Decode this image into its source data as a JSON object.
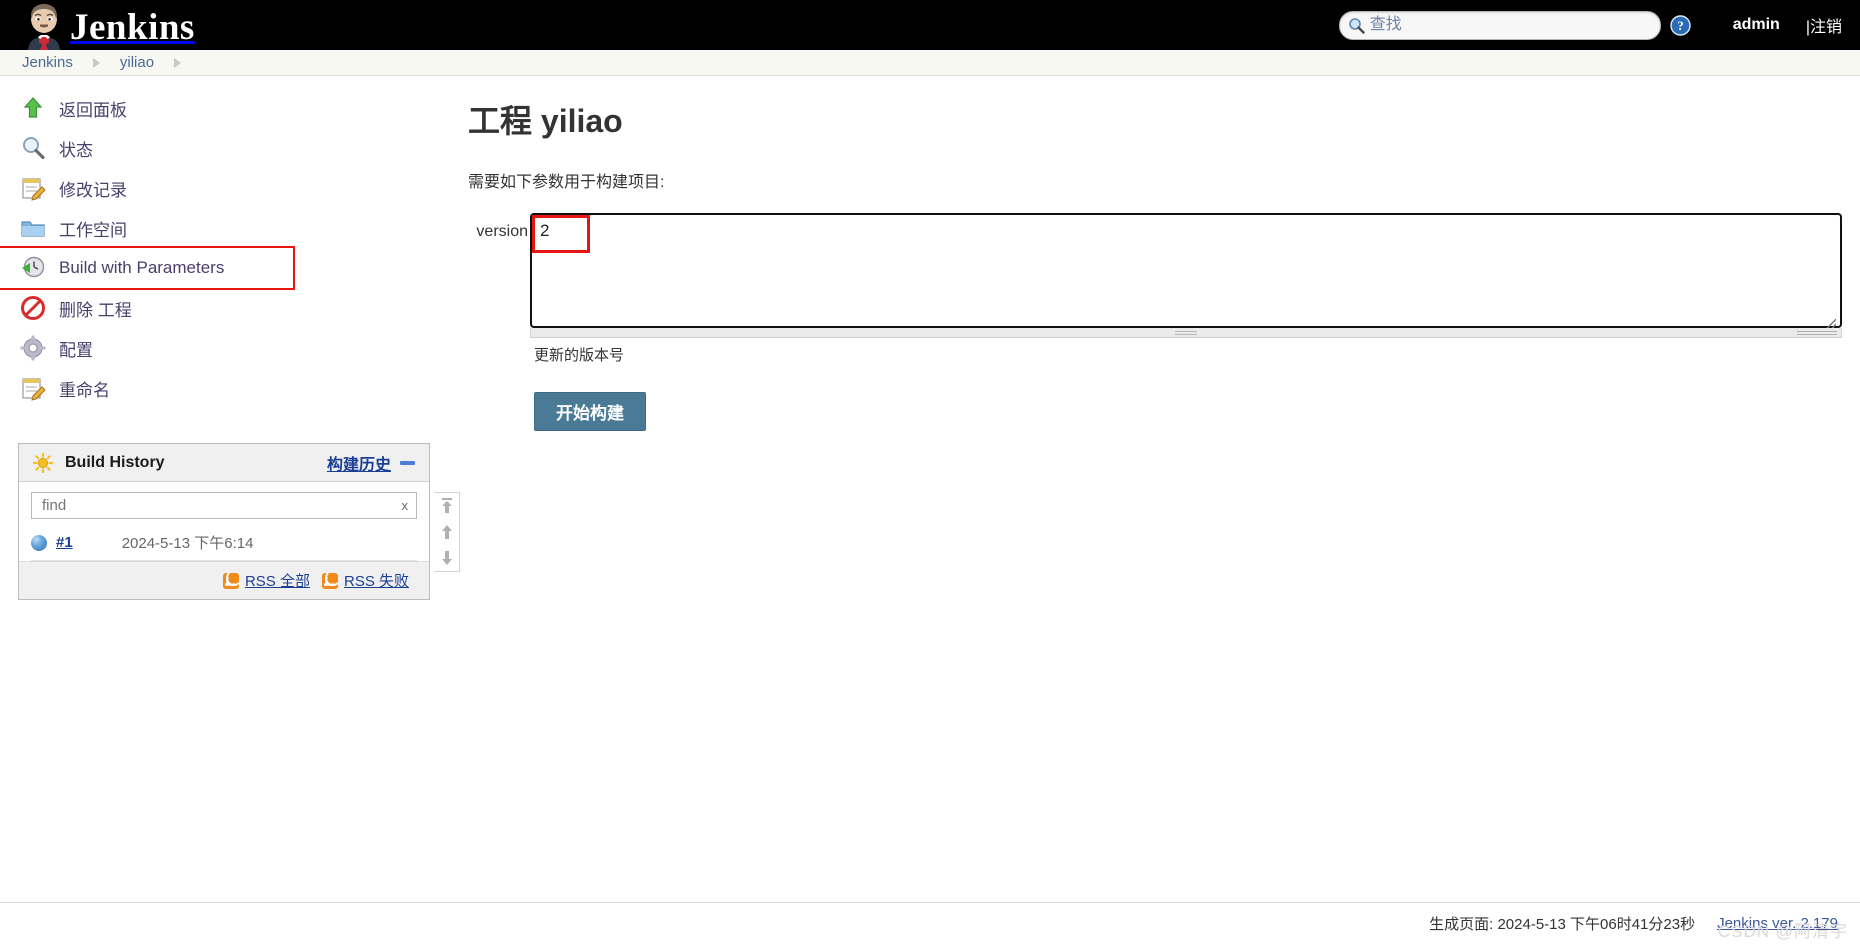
{
  "header": {
    "brand": "Jenkins",
    "butler_icon": "jenkins-butler-logo",
    "search": {
      "placeholder": "查找",
      "value": "",
      "icon": "search-icon"
    },
    "help_icon": "help-circle-icon",
    "user": "admin",
    "logout": "|注销"
  },
  "breadcrumb": {
    "items": [
      "Jenkins",
      "yiliao"
    ]
  },
  "sidebar": {
    "tasks": [
      {
        "label": "返回面板",
        "icon": "up-arrow-icon",
        "highlighted": false
      },
      {
        "label": "状态",
        "icon": "magnifier-icon",
        "highlighted": false
      },
      {
        "label": "修改记录",
        "icon": "notepad-edit-icon",
        "highlighted": false
      },
      {
        "label": "工作空间",
        "icon": "folder-icon",
        "highlighted": false
      },
      {
        "label": "Build with Parameters",
        "icon": "clock-play-icon",
        "highlighted": true
      },
      {
        "label": "删除 工程",
        "icon": "no-entry-icon",
        "highlighted": false
      },
      {
        "label": "配置",
        "icon": "gear-icon",
        "highlighted": false
      },
      {
        "label": "重命名",
        "icon": "notepad-edit-icon",
        "highlighted": false
      }
    ],
    "build_history": {
      "title": "Build History",
      "sun_icon": "sun-icon",
      "link_label": "构建历史",
      "minimize_icon": "minimize-icon",
      "find_placeholder": "find",
      "find_value": "",
      "clear_label": "x",
      "rows": [
        {
          "status_icon": "blue-ball-icon",
          "number": "#1",
          "date": "2024-5-13 下午6:14"
        }
      ],
      "rss_all": "RSS 全部",
      "rss_failed": "RSS 失败",
      "rss_icon": "rss-icon"
    },
    "scroll_arrows": [
      "scroll-to-top-icon",
      "scroll-up-icon",
      "scroll-down-icon"
    ]
  },
  "main": {
    "title": "工程 yiliao",
    "hint": "需要如下参数用于构建项目:",
    "parameter": {
      "name": "version",
      "value": "2",
      "description": "更新的版本号"
    },
    "build_button": "开始构建"
  },
  "footer": {
    "generated": "生成页面: 2024-5-13 下午06时41分23秒",
    "version": "Jenkins ver. 2.179",
    "watermark": "CSDN @阿清宇"
  }
}
